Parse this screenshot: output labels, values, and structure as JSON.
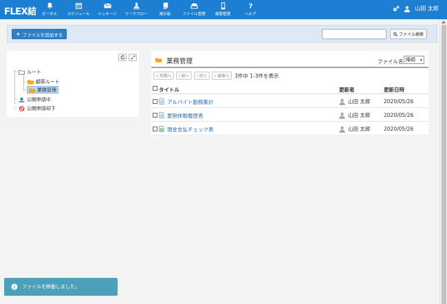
{
  "app": {
    "logo": "FLEX結"
  },
  "nav": {
    "items": [
      {
        "label": "ポータル",
        "icon": "bell-icon"
      },
      {
        "label": "スケジュール",
        "icon": "calendar-icon"
      },
      {
        "label": "メッセージ",
        "icon": "envelope-icon"
      },
      {
        "label": "ワークフロー",
        "icon": "stamp-icon"
      },
      {
        "label": "掲示板",
        "icon": "board-icon"
      },
      {
        "label": "ファイル管理",
        "icon": "drive-icon"
      },
      {
        "label": "顧客管理",
        "icon": "phone-icon"
      },
      {
        "label": "ヘルプ",
        "icon": "question-icon"
      }
    ],
    "user_name": "山田 太郎"
  },
  "toolbar": {
    "add_file_label": "ファイルを追加する",
    "search_value": "",
    "search_button_label": "ファイル検索"
  },
  "tree": {
    "root": "ルート",
    "children": [
      "顧客ルート",
      "業務管理"
    ],
    "selected": "業務管理",
    "public_pending": "公開申請中",
    "public_rejected": "公開申請却下"
  },
  "folder": {
    "title": "業務管理",
    "sort_label": "ファイル名：",
    "sort_value": "降順"
  },
  "pager": {
    "first": "« 先頭へ",
    "prev": "‹ 前へ",
    "next": "› 次へ",
    "last": "» 最後へ",
    "info": "3件中 1-3件を表示"
  },
  "table": {
    "columns": {
      "title": "タイトル",
      "updater": "更新者",
      "updated": "更新日時"
    },
    "rows": [
      {
        "title": "アルバイト勤務集計",
        "icon": "document-icon",
        "updater": "山田 太郎",
        "updated": "2020/05/26"
      },
      {
        "title": "夏期休暇履歴表",
        "icon": "document-icon",
        "updater": "山田 太郎",
        "updated": "2020/05/26"
      },
      {
        "title": "現金支払チェック表",
        "icon": "spreadsheet-icon",
        "updater": "山田 太郎",
        "updated": "2020/05/26"
      }
    ]
  },
  "toast": {
    "message": "ファイルを移動しました。"
  },
  "colors": {
    "nav_bg": "#1d7fd2",
    "toast_bg": "#4ea0ba",
    "link": "#2a6db8",
    "folder": "#f5a623",
    "reject": "#e0241b"
  }
}
